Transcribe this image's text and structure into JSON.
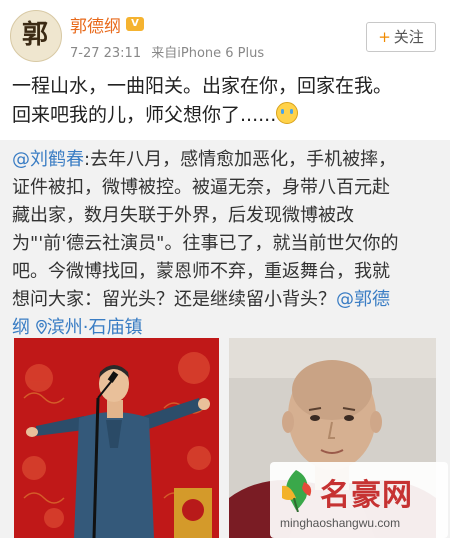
{
  "post": {
    "author": "郭德纲",
    "timestamp": "7-27 23:11",
    "source": "来自iPhone 6 Plus",
    "follow_label": "关注",
    "text_line1": "一程山水，一曲阳关。出家在你，回家在我。",
    "text_line2": "回来吧我的儿，师父想你了......",
    "emoji": "crying-face"
  },
  "repost": {
    "mention": "@刘鹤春",
    "line1_rest": ":去年八月，感情愈加恶化，手机被摔，",
    "line2": "证件被扣，微博被控。被逼无奈，身带八百元赴",
    "line3": "藏出家，数月失联于外界，后发现微博被改",
    "line4": "为\"'前'德云社演员\"。往事已了，就当前世欠你的",
    "line5": "吧。今微博找回，蒙恩师不弃，重返舞台，我就",
    "line6_start": "想问大家：留光头？还是继续留小背头？",
    "mention2": "@郭德",
    "line7_mention": "纲",
    "location": "滨州·石庙镇"
  },
  "watermark": {
    "name": "名豪网",
    "url": "minghaoshangwu.com"
  },
  "colors": {
    "username": "#e86a1c",
    "mention": "#3a7dc4",
    "repost_bg": "#f2f2f2",
    "stage_red": "#c31c1c"
  }
}
